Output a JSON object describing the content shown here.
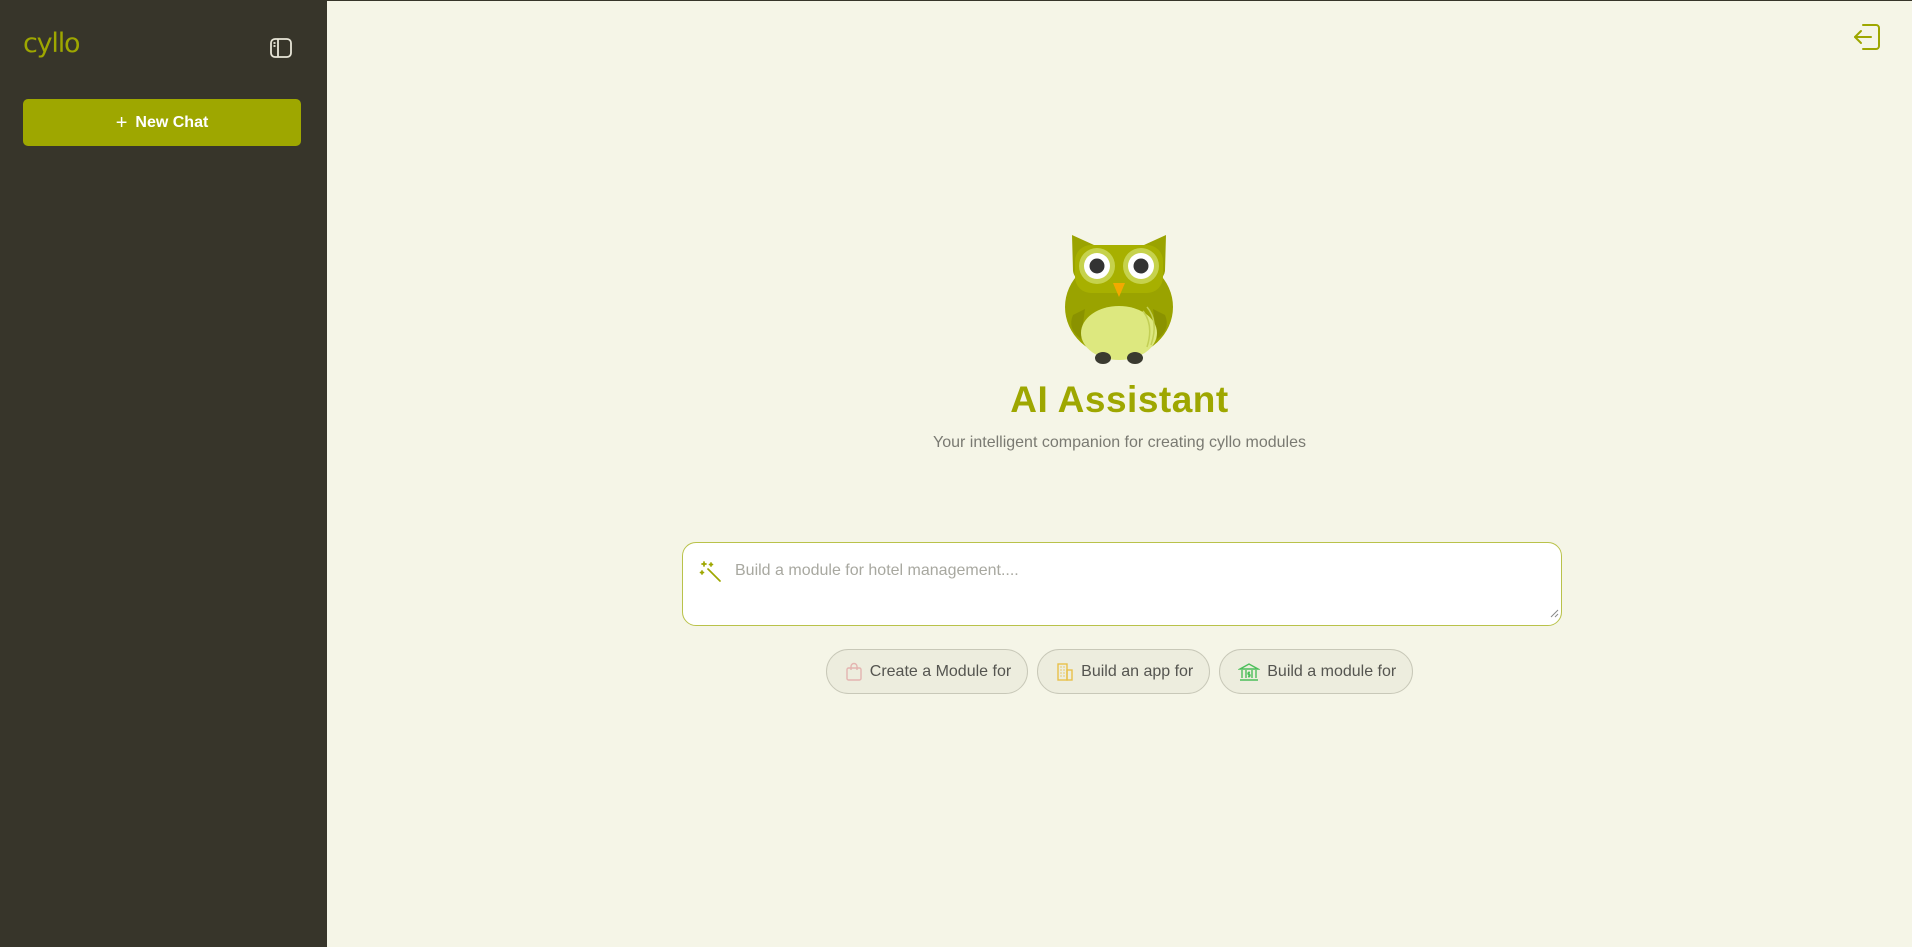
{
  "sidebar": {
    "brand": "cyllo",
    "toggle_icon": "sidebar-toggle-icon",
    "new_chat": {
      "icon": "plus-icon",
      "plus": "+",
      "label": "New Chat"
    }
  },
  "header": {
    "logout_icon": "logout-icon"
  },
  "hero": {
    "mascot": "owl-mascot",
    "title": "AI Assistant",
    "subtitle": "Your intelligent companion for creating cyllo modules"
  },
  "prompt": {
    "icon": "magic-wand-icon",
    "placeholder": "Build a module for hotel management....",
    "value": ""
  },
  "suggestions": [
    {
      "icon": "shopping-bag-icon",
      "label": "Create a Module for"
    },
    {
      "icon": "building-icon",
      "label": "Build an app for"
    },
    {
      "icon": "bank-icon",
      "label": "Build a module for"
    }
  ],
  "colors": {
    "accent": "#9ea700",
    "sidebar_bg": "#37352a",
    "main_bg": "#f5f5e7",
    "title": "#9ea700"
  }
}
